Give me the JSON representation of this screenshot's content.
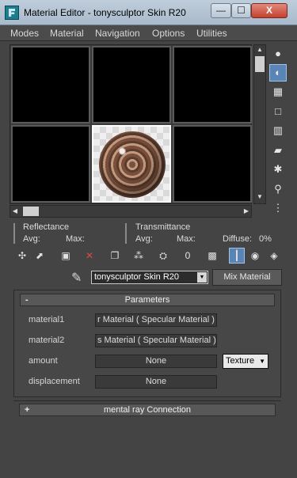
{
  "window": {
    "title": "Material Editor - tonysculptor Skin R20",
    "min_symbol": "—",
    "max_symbol": "☐",
    "close_symbol": "X"
  },
  "menu": [
    "Modes",
    "Material",
    "Navigation",
    "Options",
    "Utilities"
  ],
  "sample_slots": {
    "count": 6,
    "active_slot": 5
  },
  "side_toolbar": [
    {
      "name": "sample-type-icon",
      "glyph": "●",
      "active": false
    },
    {
      "name": "backlight-icon",
      "glyph": "◐",
      "active": true
    },
    {
      "name": "background-icon",
      "glyph": "▦",
      "active": false
    },
    {
      "name": "sample-uv-tiling-icon",
      "glyph": "□",
      "active": false
    },
    {
      "name": "video-color-check-icon",
      "glyph": "▥",
      "active": false
    },
    {
      "name": "make-preview-icon",
      "glyph": "▰",
      "active": false
    },
    {
      "name": "options-icon",
      "glyph": "✱",
      "active": false
    },
    {
      "name": "select-by-material-icon",
      "glyph": "⚲",
      "active": false
    },
    {
      "name": "material-map-navigator-icon",
      "glyph": "⋮",
      "active": false
    }
  ],
  "reflectance": {
    "title": "Reflectance",
    "avg_label": "Avg:",
    "max_label": "Max:"
  },
  "transmittance": {
    "title": "Transmittance",
    "avg_label": "Avg:",
    "max_label": "Max:",
    "diffuse_label": "Diffuse:",
    "diffuse_value": "0%"
  },
  "bottom_toolbar": [
    {
      "name": "get-material-icon",
      "glyph": "✣",
      "active": false
    },
    {
      "name": "put-material-to-scene-icon",
      "glyph": "⬈",
      "active": false
    },
    {
      "name": "assign-material-icon",
      "glyph": "▣",
      "active": false
    },
    {
      "name": "reset-map-icon",
      "glyph": "✕",
      "active": false
    },
    {
      "name": "copy-material-icon",
      "glyph": "❐",
      "active": false
    },
    {
      "name": "make-unique-icon",
      "glyph": "⁂",
      "active": false
    },
    {
      "name": "put-to-library-icon",
      "glyph": "⛭",
      "active": false
    },
    {
      "name": "material-id-channel-icon",
      "glyph": "0",
      "active": false
    },
    {
      "name": "show-shaded-material-icon",
      "glyph": "▩",
      "active": false
    },
    {
      "name": "show-end-result-icon",
      "glyph": "┃",
      "active": true
    },
    {
      "name": "go-to-parent-icon",
      "glyph": "◉",
      "active": false
    },
    {
      "name": "go-forward-to-sibling-icon",
      "glyph": "◈",
      "active": false
    }
  ],
  "material": {
    "eyedropper": "pick-material-icon",
    "name": "tonysculptor Skin R20",
    "type_button": "Mix Material"
  },
  "parameters": {
    "header": "Parameters",
    "collapse_sign": "-",
    "material1_label": "material1",
    "material1_value": "r Material  ( Specular Material )",
    "material2_label": "material2",
    "material2_value": "s Material  ( Specular Material )",
    "amount_label": "amount",
    "amount_value": "None",
    "amount_dropdown": "Texture",
    "displacement_label": "displacement",
    "displacement_value": "None"
  },
  "mental_ray": {
    "header": "mental ray Connection",
    "expand_sign": "+"
  },
  "colors": {
    "panel_bg": "#444444",
    "active_tool": "#5a84b4",
    "titlebar": "#bfcddb",
    "close_button": "#c4402d"
  }
}
